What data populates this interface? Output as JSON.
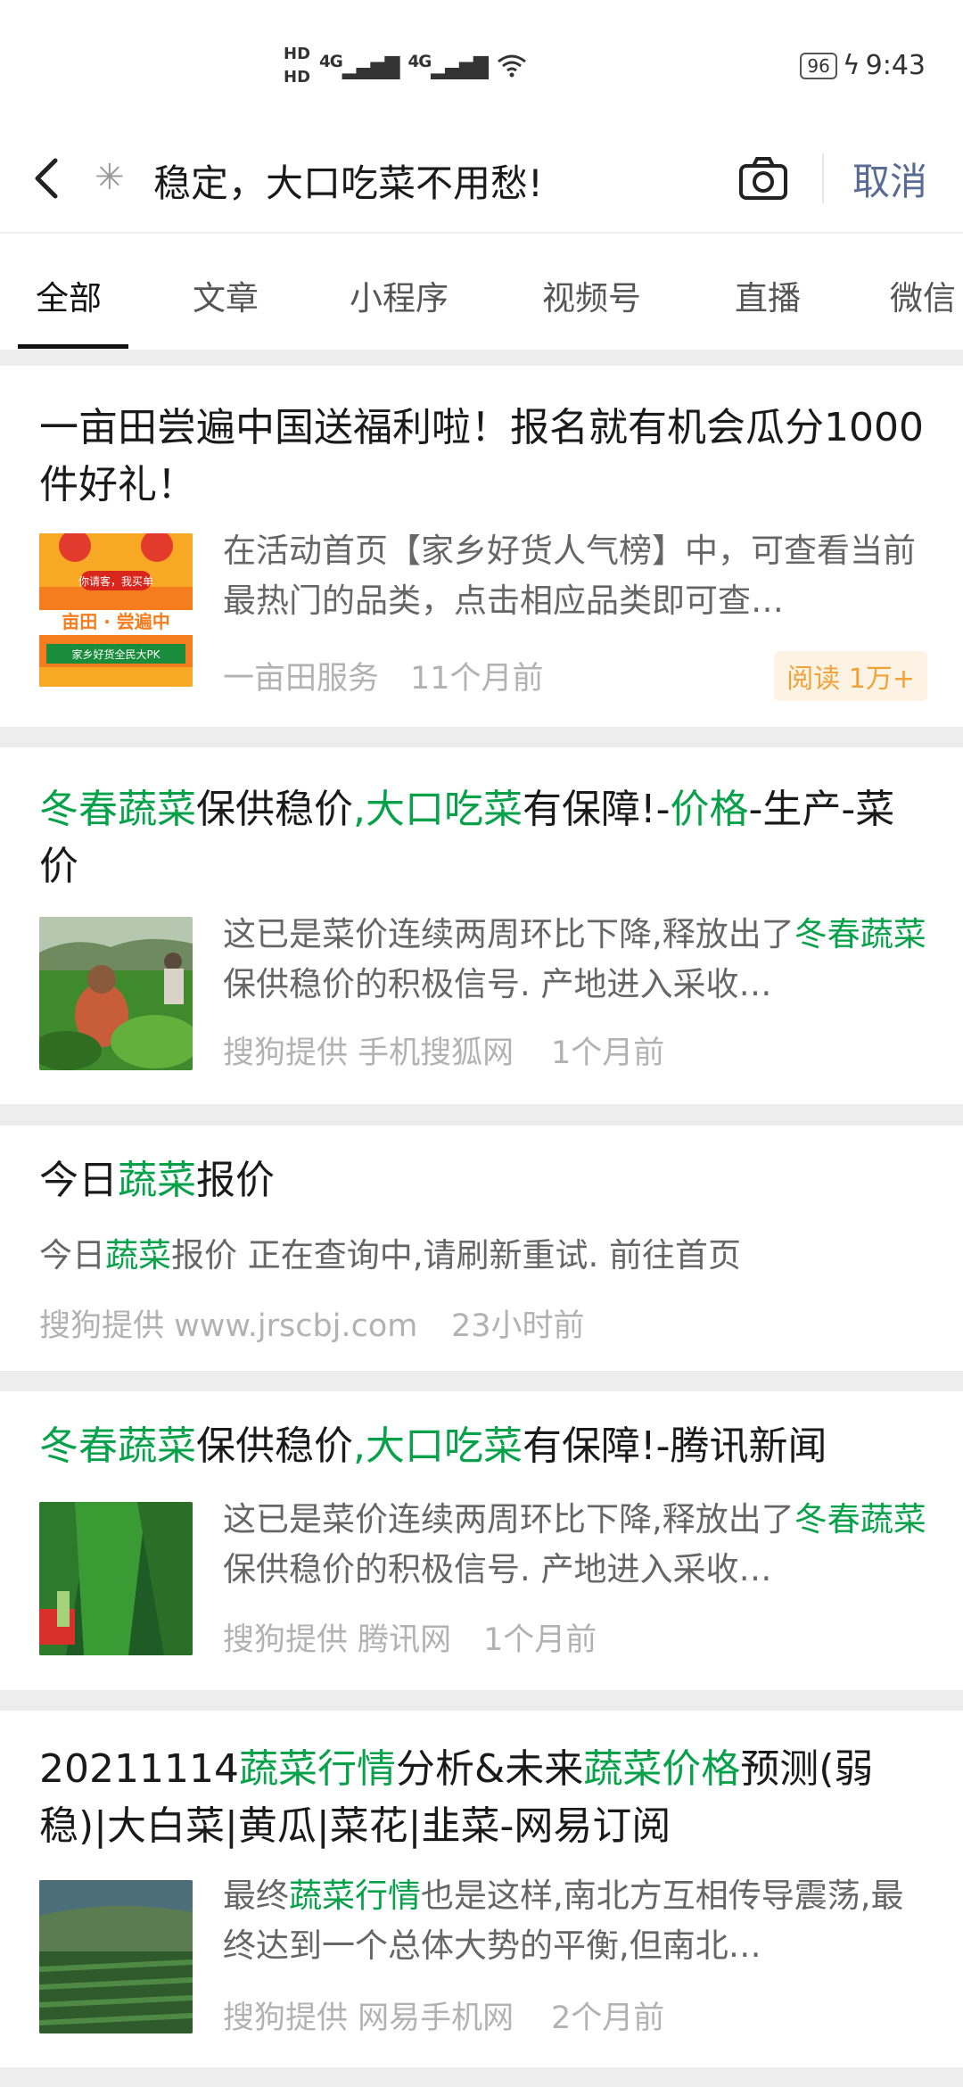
{
  "status": {
    "hd1": "HD",
    "hd2": "HD",
    "net1": "4G",
    "net2": "4G",
    "battery": "96",
    "time": "9:43"
  },
  "search": {
    "query": "稳定，大口吃菜不用愁!",
    "cancel": "取消"
  },
  "tabs": [
    "全部",
    "文章",
    "小程序",
    "视频号",
    "直播",
    "微信"
  ],
  "results": [
    {
      "title": "一亩田尝遍中国送福利啦！报名就有机会瓜分1000件好礼！",
      "snippet": "在活动首页【家乡好货人气榜】中，可查看当前最热门的品类，点击相应品类即可查…",
      "source": "一亩田服务",
      "time": "11个月前",
      "badge": "阅读 1万+",
      "thumb_text1": "你请客，我买单",
      "thumb_text2": "亩田 · 尝遍中",
      "thumb_text3": "家乡好货全民大PK"
    },
    {
      "title_parts": [
        "冬春蔬菜",
        "保供稳价",
        ",大口吃菜",
        "有保障!-",
        "价格",
        "-生产-菜价"
      ],
      "snippet_parts": [
        "这已是菜价连续两周环比下降,释放出了",
        "冬春蔬菜",
        "保供稳价的积极信号. 产地进入采收…"
      ],
      "source": "搜狗提供 手机搜狐网",
      "time": "1个月前"
    },
    {
      "title_parts": [
        "今日",
        "蔬菜",
        "报价"
      ],
      "snippet_parts": [
        "今日",
        "蔬菜",
        "报价 正在查询中,请刷新重试. 前往首页"
      ],
      "source": "搜狗提供 www.jrscbj.com",
      "time": "23小时前"
    },
    {
      "title_parts": [
        "冬春蔬菜",
        "保供稳价",
        ",大口吃菜",
        "有保障!-腾讯新闻"
      ],
      "snippet_parts": [
        "这已是菜价连续两周环比下降,释放出了",
        "冬春蔬菜",
        "保供稳价的积极信号. 产地进入采收…"
      ],
      "source": "搜狗提供 腾讯网",
      "time": "1个月前"
    },
    {
      "title_parts": [
        "20211114",
        "蔬菜行情",
        "分析&未来",
        "蔬菜价格",
        "预测(弱稳)|大白菜|黄瓜|菜花|韭菜-网易订阅"
      ],
      "snippet_parts": [
        "最终",
        "蔬菜行情",
        "也是这样,南北方互相传导震荡,最终达到一个总体大势的平衡,但南北…"
      ],
      "source": "搜狗提供 网易手机网",
      "time": "2个月前"
    }
  ],
  "colors": {
    "highlight": "#07a14a",
    "link": "#576b95",
    "badge": "#f1a33a"
  }
}
